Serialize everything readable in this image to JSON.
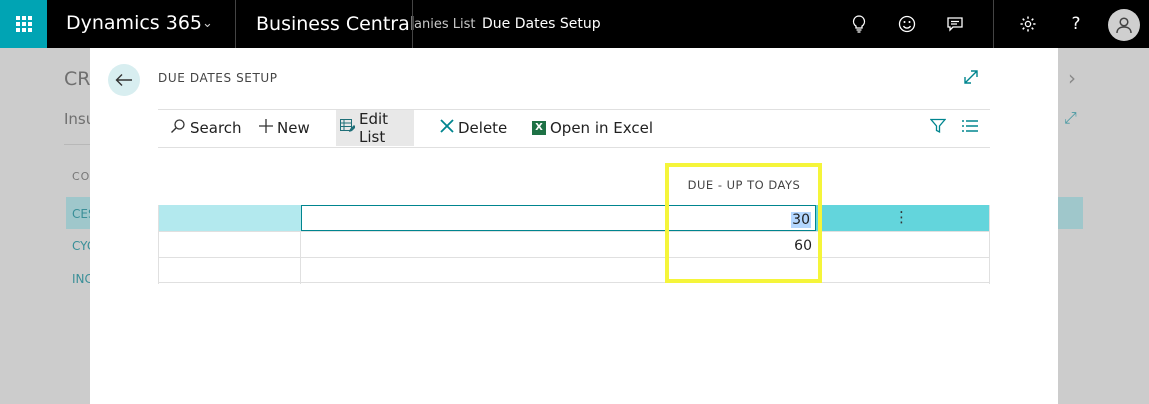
{
  "topbar": {
    "brand": "Dynamics 365",
    "app_name": "Business Central",
    "breadcrumb_prev": "anies List",
    "breadcrumb_current": "Due Dates Setup",
    "icons": [
      "lightbulb-icon",
      "smiley-icon",
      "chat-icon",
      "gear-icon",
      "help-icon",
      "user-icon"
    ],
    "accent_color": "#00a4b4"
  },
  "background_page": {
    "title": "CR",
    "subtitle": "Insu",
    "column_header": "CO",
    "rows": [
      "CES",
      "CYC",
      "INC"
    ]
  },
  "modal": {
    "title": "DUE DATES SETUP",
    "toolbar": {
      "search": "Search",
      "new": "New",
      "edit_list": "Edit List",
      "delete": "Delete",
      "open_in_excel": "Open in Excel"
    },
    "table": {
      "columns": [
        "",
        "",
        "DUE - UP TO DAYS",
        ""
      ],
      "rows": [
        {
          "due_up_to_days": "30",
          "selected": true
        },
        {
          "due_up_to_days": "60",
          "selected": false
        },
        {
          "due_up_to_days": "",
          "selected": false
        }
      ]
    },
    "highlight_color": "#f5f53a",
    "selected_row_color": "#63d5dc"
  }
}
